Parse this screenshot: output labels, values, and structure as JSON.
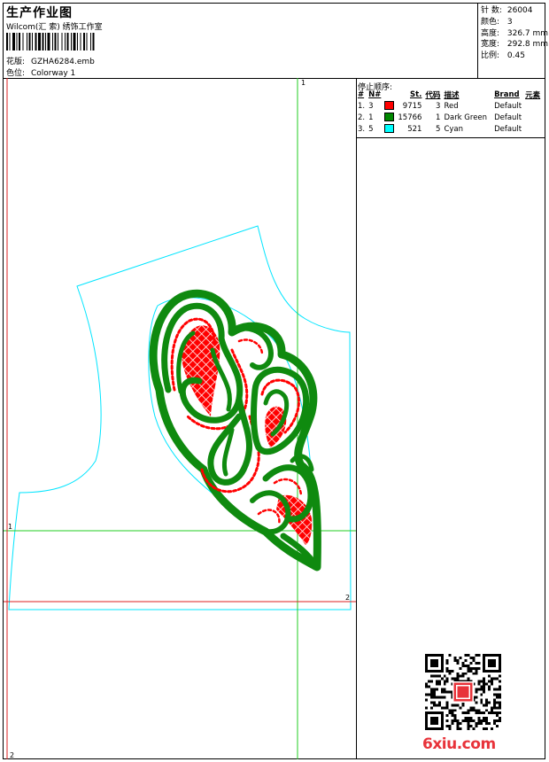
{
  "header": {
    "title": "生产作业图",
    "subtitle": "Wilcom(汇 索) 绣饰工作室",
    "design_label": "花版:",
    "design_value": "GZHA6284.emb",
    "colorway_label": "色位:",
    "colorway_value": "Colorway 1"
  },
  "specs": {
    "stitches_label": "针 数:",
    "stitches_value": "26004",
    "colors_label": "颜色:",
    "colors_value": "3",
    "height_label": "高度:",
    "height_value": "326.7 mm",
    "width_label": "宽度:",
    "width_value": "292.8 mm",
    "scale_label": "比例:",
    "scale_value": "0.45"
  },
  "stop_sequence": {
    "title": "停止顺序:",
    "columns": [
      "#",
      "N#",
      "St.",
      "代码",
      "描述",
      "Brand",
      "元素"
    ],
    "rows": [
      {
        "num": "1.",
        "n": "3",
        "color": "#ff0000",
        "stitches": "9715",
        "code": "3",
        "desc": "Red",
        "brand": "Default"
      },
      {
        "num": "2.",
        "n": "1",
        "color": "#008800",
        "stitches": "15766",
        "code": "1",
        "desc": "Dark Green",
        "brand": "Default"
      },
      {
        "num": "3.",
        "n": "5",
        "color": "#00ffff",
        "stitches": "521",
        "code": "5",
        "desc": "Cyan",
        "brand": "Default"
      }
    ]
  },
  "guides": {
    "v1_label": "1",
    "h1_label": "1",
    "h2_label": "2",
    "v2_label": "2"
  },
  "watermark": {
    "text": "6xiu.com"
  },
  "colors": {
    "red": "#ff0000",
    "green": "#0f8a0f",
    "cyan": "#00e5ff",
    "guide_green": "#22cc22",
    "guide_red": "#dd2222"
  }
}
